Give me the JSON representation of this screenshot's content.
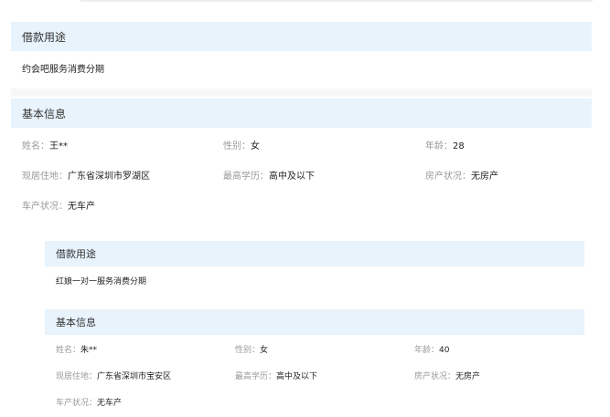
{
  "outer": {
    "purpose_header": "借款用途",
    "purpose_text": "约会吧服务消费分期",
    "basic_header": "基本信息",
    "fields": {
      "name": {
        "label": "姓名：",
        "value": "王**"
      },
      "gender": {
        "label": "性别：",
        "value": "女"
      },
      "age": {
        "label": "年龄：",
        "value": "28"
      },
      "residence": {
        "label": "现居住地：",
        "value": "广东省深圳市罗湖区"
      },
      "education": {
        "label": "最高学历：",
        "value": "高中及以下"
      },
      "house": {
        "label": "房产状况：",
        "value": "无房产"
      },
      "car": {
        "label": "车产状况：",
        "value": "无车产"
      }
    }
  },
  "inner": {
    "purpose_header": "借款用途",
    "purpose_text": "红娘一对一服务消费分期",
    "basic_header": "基本信息",
    "fields": {
      "name": {
        "label": "姓名：",
        "value": "朱**"
      },
      "gender": {
        "label": "性别：",
        "value": "女"
      },
      "age": {
        "label": "年龄：",
        "value": "40"
      },
      "residence": {
        "label": "现居住地：",
        "value": "广东省深圳市宝安区"
      },
      "education": {
        "label": "最高学历：",
        "value": "高中及以下"
      },
      "house": {
        "label": "房产状况：",
        "value": "无房产"
      },
      "car": {
        "label": "车产状况：",
        "value": "无车产"
      }
    }
  }
}
